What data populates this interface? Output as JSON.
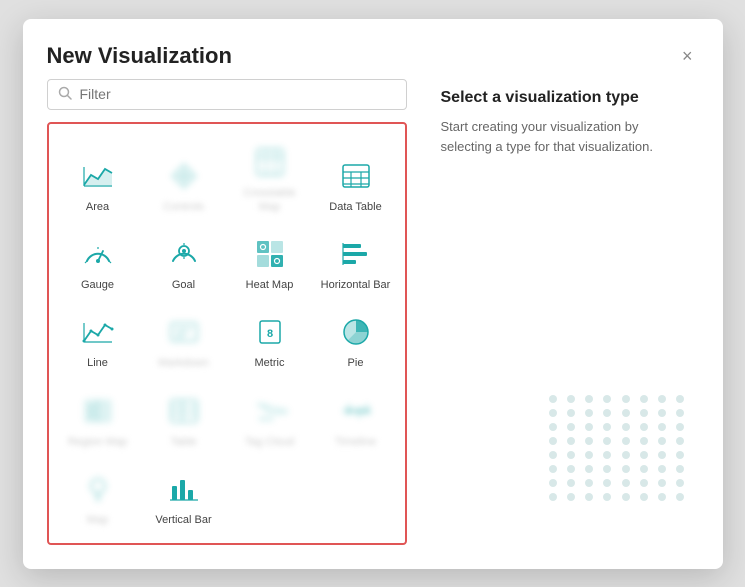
{
  "modal": {
    "title": "New Visualization",
    "close_label": "×"
  },
  "filter": {
    "placeholder": "Filter"
  },
  "right_panel": {
    "title": "Select a visualization type",
    "description": "Start creating your visualization by selecting a type for that visualization."
  },
  "viz_items": [
    {
      "id": "area",
      "label": "Area",
      "blur": false
    },
    {
      "id": "controls",
      "label": "Controls",
      "blur": true
    },
    {
      "id": "crosstab",
      "label": "Crosstable Map",
      "blur": true
    },
    {
      "id": "datatable",
      "label": "Data Table",
      "blur": false
    },
    {
      "id": "gauge",
      "label": "Gauge",
      "blur": false
    },
    {
      "id": "goal",
      "label": "Goal",
      "blur": false
    },
    {
      "id": "heatmap",
      "label": "Heat Map",
      "blur": false
    },
    {
      "id": "horizontalbar",
      "label": "Horizontal Bar",
      "blur": false
    },
    {
      "id": "line",
      "label": "Line",
      "blur": false
    },
    {
      "id": "markdown",
      "label": "Markdown",
      "blur": true
    },
    {
      "id": "metric",
      "label": "Metric",
      "blur": false
    },
    {
      "id": "pie",
      "label": "Pie",
      "blur": false
    },
    {
      "id": "regionmap",
      "label": "Region Map",
      "blur": true
    },
    {
      "id": "table",
      "label": "Table",
      "blur": true
    },
    {
      "id": "tagcloud",
      "label": "Tag Cloud",
      "blur": true
    },
    {
      "id": "timeline",
      "label": "Timeline",
      "blur": true
    },
    {
      "id": "map",
      "label": "Map",
      "blur": true
    },
    {
      "id": "verticalbar",
      "label": "Vertical Bar",
      "blur": false
    }
  ]
}
